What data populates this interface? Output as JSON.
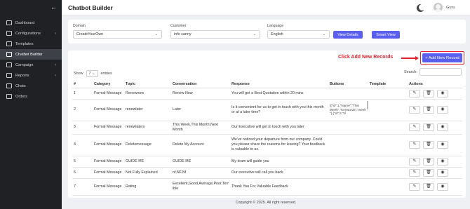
{
  "sidebar": {
    "items": [
      {
        "label": "Dashboard",
        "icon": "dashboard-icon",
        "chevron": false,
        "active": false
      },
      {
        "label": "Configurations",
        "icon": "settings-icon",
        "chevron": true,
        "active": false
      },
      {
        "label": "Templates",
        "icon": "template-icon",
        "chevron": false,
        "active": false
      },
      {
        "label": "Chatbot Builder",
        "icon": "chatbot-icon",
        "chevron": false,
        "active": true
      },
      {
        "label": "Campaign",
        "icon": "campaign-icon",
        "chevron": true,
        "active": false
      },
      {
        "label": "Reports",
        "icon": "reports-icon",
        "chevron": true,
        "active": false
      },
      {
        "label": "Chats",
        "icon": "chat-icon",
        "chevron": false,
        "active": false
      },
      {
        "label": "Orders",
        "icon": "orders-icon",
        "chevron": false,
        "active": false
      }
    ],
    "back_icon": "←"
  },
  "header": {
    "title": "Chatbot Builder",
    "user": "Guru"
  },
  "filters": {
    "domain_label": "Domain",
    "domain_value": "CreateYourOwn",
    "customer_label": "Customer",
    "customer_value": "info canny",
    "language_label": "Language",
    "language_value": "English",
    "view_details": "View Details",
    "smart_view": "Smart View"
  },
  "annotation": {
    "text": "Click Add New Records"
  },
  "add_button": "+ Add New Record",
  "table_controls": {
    "show": "Show",
    "entries_count": "7",
    "entries": "entries",
    "search_label": "Search:"
  },
  "columns": [
    "#",
    "Category",
    "Topic",
    "Conversation",
    "Response",
    "Buttons",
    "Template",
    "Actions"
  ],
  "rows": [
    {
      "num": "1",
      "category": "Formal Message",
      "topic": "Renewnow",
      "conversation": "Renew Now",
      "response": "You will get a Best Quotation within 20 mins",
      "buttons": "",
      "template": ""
    },
    {
      "num": "2",
      "category": "Formal Message",
      "topic": "renewlater",
      "conversation": "Later",
      "response": "Is it convenient for us to get in touch with you this month or at a later time?",
      "buttons": "[{\"id\":1,\"Name\":\"This Week\",\"Keywords\":\"week\"},{\"id\":2,\"N",
      "template": ""
    },
    {
      "num": "3",
      "category": "Formal Message",
      "topic": "renewlaters",
      "conversation": "This Week,This Month,Next Month",
      "response": "Our Executive will get in touch with you later",
      "buttons": "",
      "template": ""
    },
    {
      "num": "4",
      "category": "Formal Message",
      "topic": "Deletemessage",
      "conversation": "Delete My Account",
      "response": "We've noticed your departure from our company. Could you please share the reasons for leaving? Your feedback is valuable to us.",
      "buttons": "",
      "template": ""
    },
    {
      "num": "5",
      "category": "Formal Message",
      "topic": "GUIDE ME",
      "conversation": "GUIDE ME",
      "response": "My team will guide you",
      "buttons": "",
      "template": ""
    },
    {
      "num": "6",
      "category": "Formal Message",
      "topic": "Not Fully Explained",
      "conversation": "nf,NF,Nf",
      "response": "Our executive will call you back",
      "buttons": "",
      "template": ""
    },
    {
      "num": "7",
      "category": "Formal Message",
      "topic": "Rating",
      "conversation": "Excellent,Good,Average,Poor,Terrible",
      "response": "Thank You For Valuable Feedback",
      "buttons": "",
      "template": ""
    }
  ],
  "footer": "Copyright © 2025. All right reserved.",
  "colors": {
    "accent": "#5b5ff0",
    "sidebar_bg": "#1f2125",
    "annotation": "#e0212e"
  }
}
